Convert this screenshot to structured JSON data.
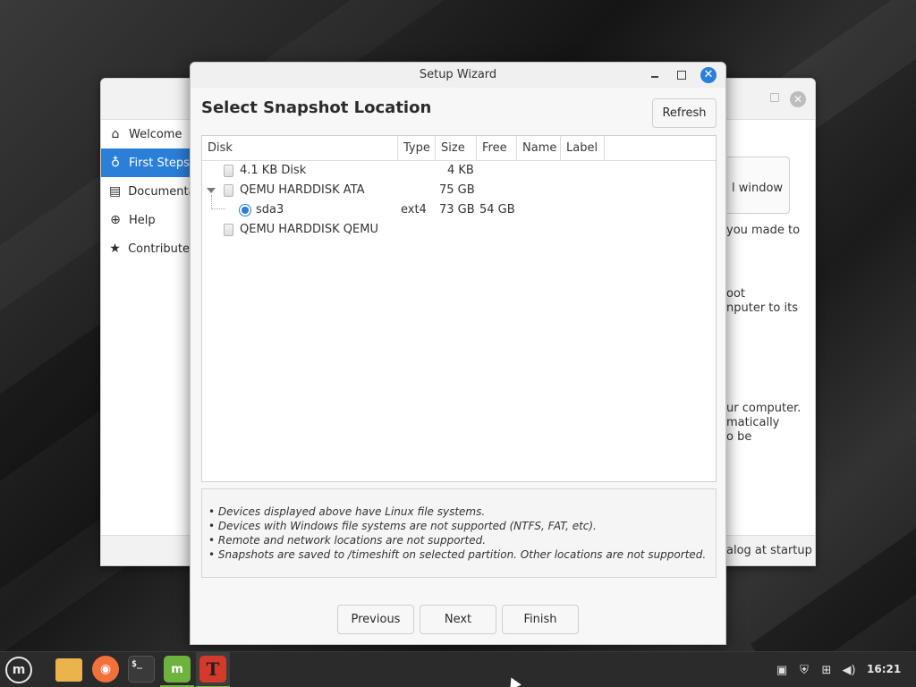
{
  "background_window": {
    "sidebar": [
      {
        "label": "Welcome",
        "icon": "home-icon",
        "active": false
      },
      {
        "label": "First Steps",
        "icon": "lightbulb-icon",
        "active": true
      },
      {
        "label": "Documenta",
        "icon": "book-icon",
        "active": false
      },
      {
        "label": "Help",
        "icon": "lifebuoy-icon",
        "active": false
      },
      {
        "label": "Contribute",
        "icon": "star-icon",
        "active": false
      }
    ],
    "visible_text": {
      "window_button": "l window",
      "made_to": "you made to",
      "oot": "oot",
      "computer_to_its": "nputer to its",
      "ur_computer": "ur computer.",
      "matically": "matically",
      "o_be": "o be",
      "footer_startup": "alog at startup"
    }
  },
  "wizard": {
    "title": "Setup Wizard",
    "heading": "Select Snapshot Location",
    "refresh_label": "Refresh",
    "columns": [
      "Disk",
      "Type",
      "Size",
      "Free",
      "Name",
      "Label"
    ],
    "rows": [
      {
        "disk": "4.1 KB Disk",
        "type": "",
        "size": "4 KB",
        "free": "",
        "level": 0,
        "kind": "disk"
      },
      {
        "disk": "QEMU HARDDISK ATA",
        "type": "",
        "size": "75 GB",
        "free": "",
        "level": 0,
        "kind": "disk-expanded"
      },
      {
        "disk": "sda3",
        "type": "ext4",
        "size": "73 GB",
        "free": "54 GB",
        "level": 1,
        "kind": "partition-selected"
      },
      {
        "disk": "QEMU HARDDISK QEMU",
        "type": "",
        "size": "",
        "free": "",
        "level": 0,
        "kind": "disk"
      }
    ],
    "notes": [
      "• Devices displayed above have Linux file systems.",
      "• Devices with Windows file systems are not supported (NTFS, FAT, etc).",
      "• Remote and network locations are not supported.",
      "• Snapshots are saved to /timeshift on selected partition. Other locations are not supported."
    ],
    "buttons": {
      "previous": "Previous",
      "next": "Next",
      "finish": "Finish"
    }
  },
  "taskbar": {
    "clock": "16:21",
    "apps": [
      "menu-icon",
      "files-icon",
      "firefox-icon",
      "terminal-icon",
      "software-manager-icon",
      "timeshift-icon"
    ],
    "tray": [
      "clipboard-icon",
      "shield-icon",
      "network-icon",
      "volume-icon"
    ]
  },
  "colors": {
    "accent": "#2a7fd8",
    "active_app_indicator": "#6fb33f"
  }
}
